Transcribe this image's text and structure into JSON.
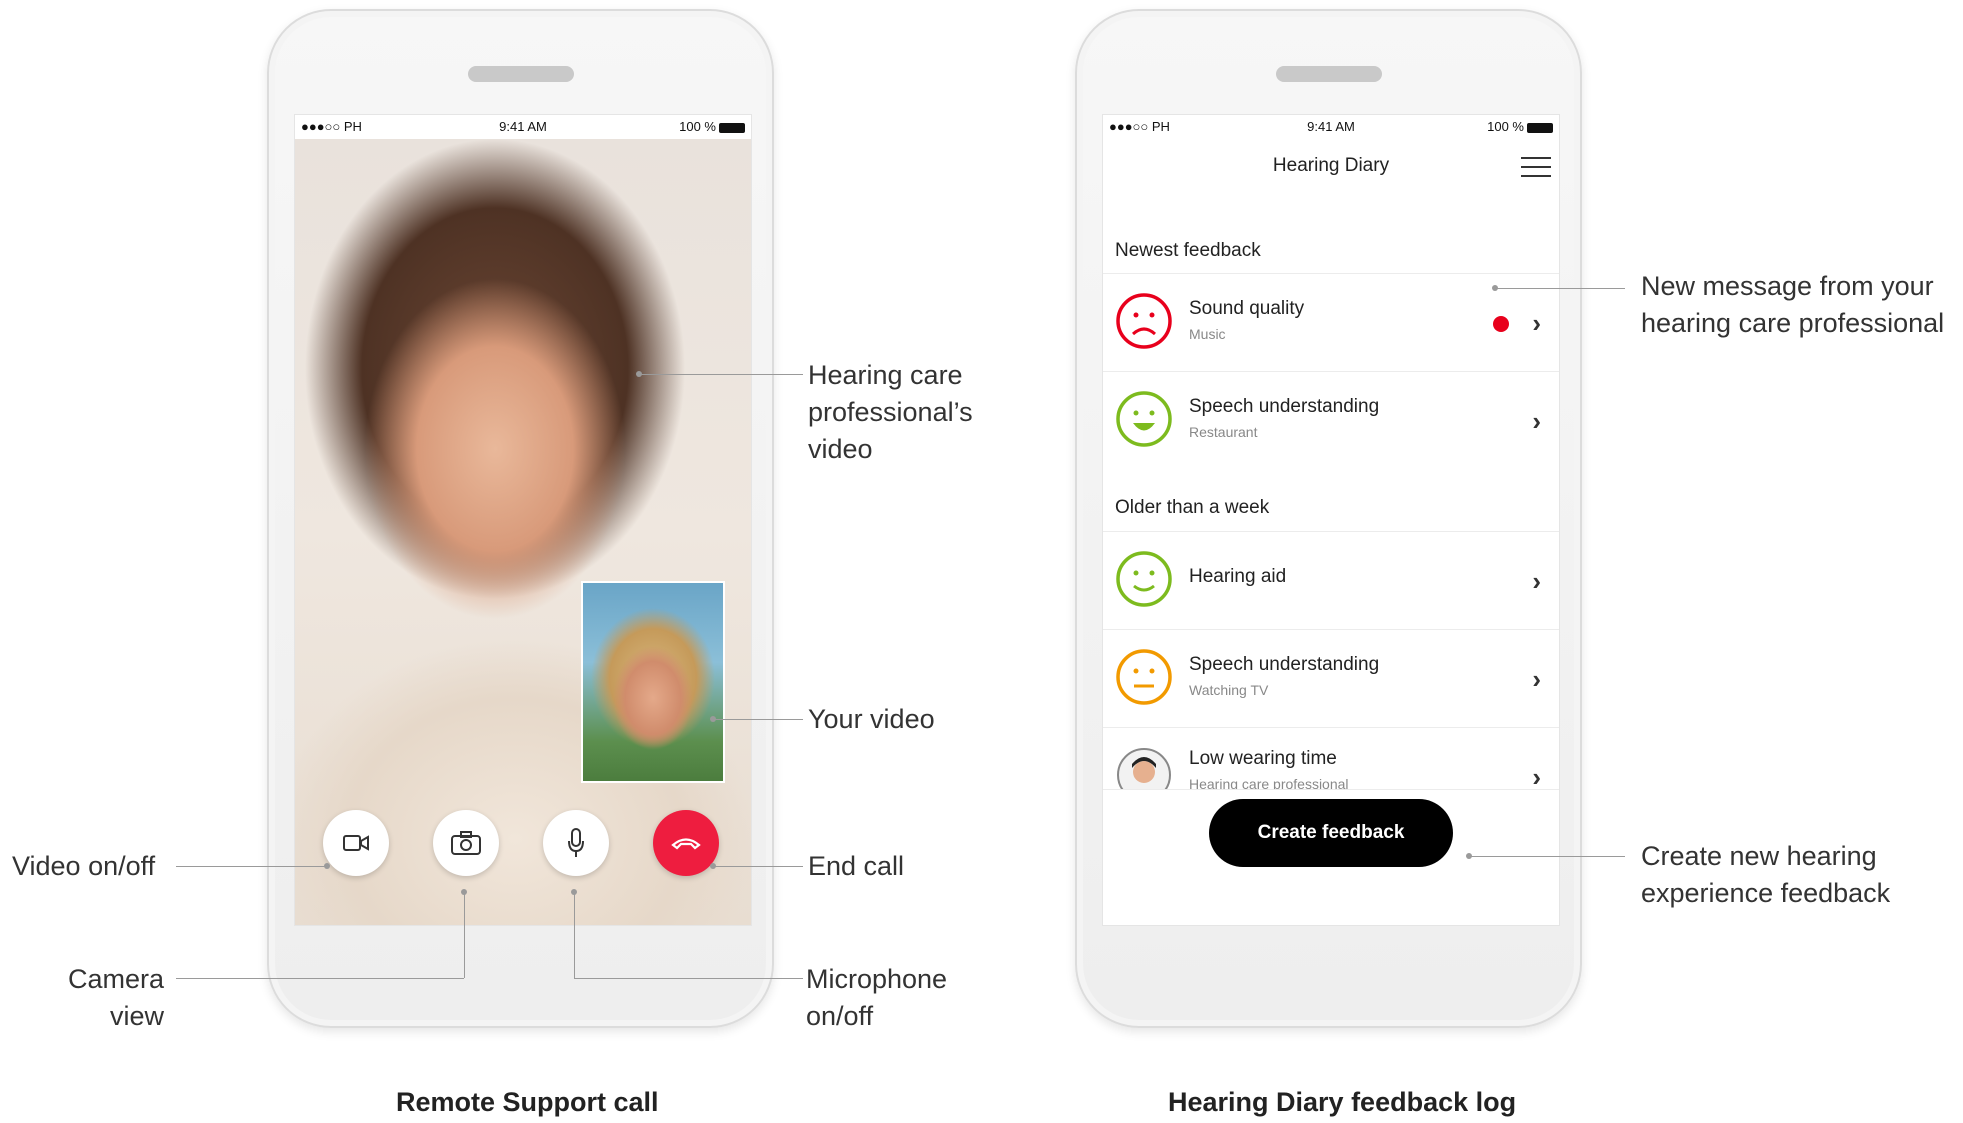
{
  "status_bar": {
    "carrier": "●●●○○ PH",
    "time": "9:41 AM",
    "battery": "100 %"
  },
  "remote_call": {
    "caption": "Remote Support call",
    "callouts": {
      "professional_video": "Hearing care professional’s video",
      "your_video": "Your video",
      "video_toggle": "Video on/off",
      "camera_view": "Camera view",
      "microphone": "Microphone on/off",
      "end_call": "End call"
    }
  },
  "diary": {
    "caption": "Hearing Diary feedback log",
    "nav_title": "Hearing Diary",
    "sections": {
      "newest": "Newest feedback",
      "older": "Older than a week"
    },
    "items": [
      {
        "title": "Sound quality",
        "subtitle": "Music",
        "mood": "sad",
        "color": "#e8001c",
        "unread": true
      },
      {
        "title": "Speech understanding",
        "subtitle": "Restaurant",
        "mood": "happy",
        "color": "#7dbb1e",
        "unread": false
      },
      {
        "title": "Hearing aid",
        "subtitle": "",
        "mood": "smile",
        "color": "#7dbb1e",
        "unread": false
      },
      {
        "title": "Speech understanding",
        "subtitle": "Watching TV",
        "mood": "neutral",
        "color": "#f29a00",
        "unread": false
      },
      {
        "title": "Low wearing time",
        "subtitle": "Hearing care professional",
        "mood": "avatar",
        "color": "#555555",
        "unread": false
      }
    ],
    "create_button": "Create feedback",
    "callouts": {
      "new_message": "New message from your hearing care professional",
      "create_new": "Create new hearing experience feedback"
    }
  },
  "colors": {
    "end_call": "#ee1d3f",
    "unread_dot": "#e8001c",
    "button": "#000000"
  }
}
